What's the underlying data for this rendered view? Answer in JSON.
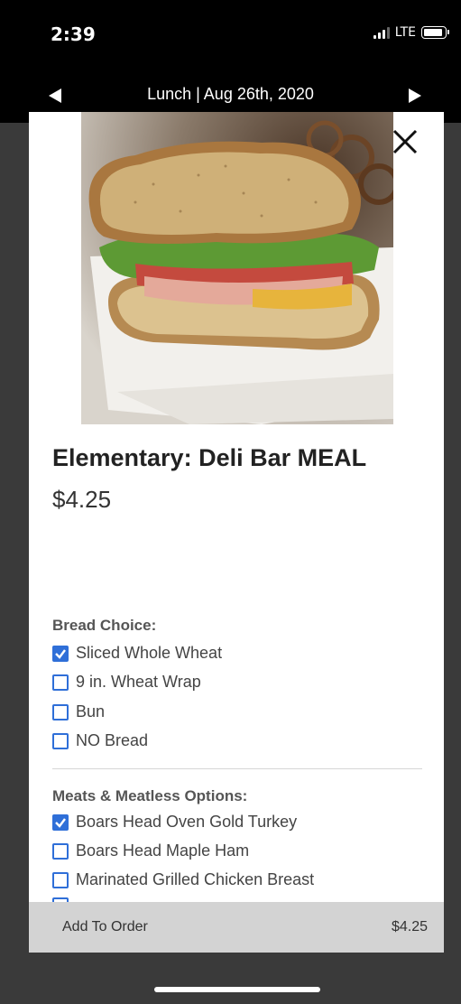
{
  "status_bar": {
    "time": "2:39",
    "network": "LTE"
  },
  "nav": {
    "title": "Lunch | Aug 26th, 2020"
  },
  "item": {
    "image_icon": "sandwich-photo",
    "title": "Elementary: Deli Bar MEAL",
    "price": "$4.25"
  },
  "sections": {
    "bread": {
      "heading": "Bread Choice:",
      "options": [
        {
          "label": "Sliced Whole Wheat",
          "checked": true
        },
        {
          "label": "9 in. Wheat Wrap",
          "checked": false
        },
        {
          "label": "Bun",
          "checked": false
        },
        {
          "label": "NO Bread",
          "checked": false
        }
      ]
    },
    "meats": {
      "heading": "Meats & Meatless Options:",
      "options": [
        {
          "label": "Boars Head Oven Gold Turkey",
          "checked": true
        },
        {
          "label": "Boars Head Maple Ham",
          "checked": false
        },
        {
          "label": "Marinated Grilled Chicken Breast",
          "checked": false
        }
      ]
    }
  },
  "order_bar": {
    "label": "Add To Order",
    "total": "$4.25"
  },
  "colors": {
    "accent": "#2f6fd8",
    "nav_bg": "#000000",
    "order_bar_bg": "#d3d3d3"
  }
}
